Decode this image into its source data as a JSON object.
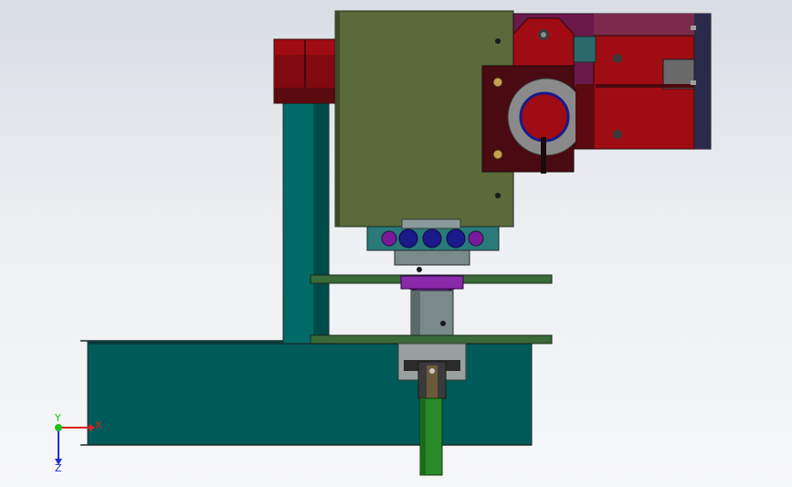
{
  "viewport": {
    "background_top": "#d9dde4",
    "background_bottom": "#f6f7f8"
  },
  "triad": {
    "x_label": "X",
    "y_label": "Y",
    "z_label": "Z",
    "x_color": "#e02020",
    "y_color": "#20c020",
    "z_color": "#2030d0"
  },
  "colors": {
    "base_plate": "#005a58",
    "column": "#006a66",
    "housing": "#5a6a3a",
    "bracket_dark": "#4a0a12",
    "bracket_red": "#a00c14",
    "coupling_ring": "#7a1a9a",
    "shaft_grey": "#7a8a8a",
    "rod_green": "#2a8a2a",
    "rail_green": "#3a6a3a"
  }
}
